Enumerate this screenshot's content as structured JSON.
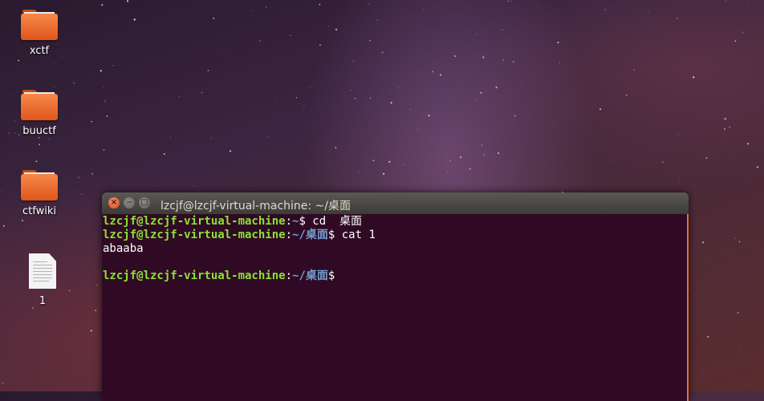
{
  "desktop": {
    "icons": [
      {
        "label": "xctf",
        "type": "folder-icon"
      },
      {
        "label": "buuctf",
        "type": "folder-icon"
      },
      {
        "label": "ctfwiki",
        "type": "folder-icon"
      },
      {
        "label": "1",
        "type": "text-file-icon"
      }
    ]
  },
  "terminal": {
    "title": "lzcjf@lzcjf-virtual-machine: ~/桌面",
    "buttons": {
      "close": "×",
      "minimize": "−",
      "maximize": "□"
    },
    "lines": [
      {
        "user": "lzcjf@lzcjf-virtual-machine",
        "sep": ":",
        "path": "~",
        "cmd": "$ cd  桌面"
      },
      {
        "user": "lzcjf@lzcjf-virtual-machine",
        "sep": ":",
        "path": "~/桌面",
        "cmd": "$ cat 1"
      },
      {
        "output": "abaaba"
      },
      {
        "output": ""
      },
      {
        "user": "lzcjf@lzcjf-virtual-machine",
        "sep": ":",
        "path": "~/桌面",
        "cmd": "$"
      }
    ]
  },
  "colors": {
    "terminal_bg": "#300a24",
    "prompt_user": "#8ae234",
    "prompt_path": "#729fcf",
    "folder": "#f07a3c"
  }
}
